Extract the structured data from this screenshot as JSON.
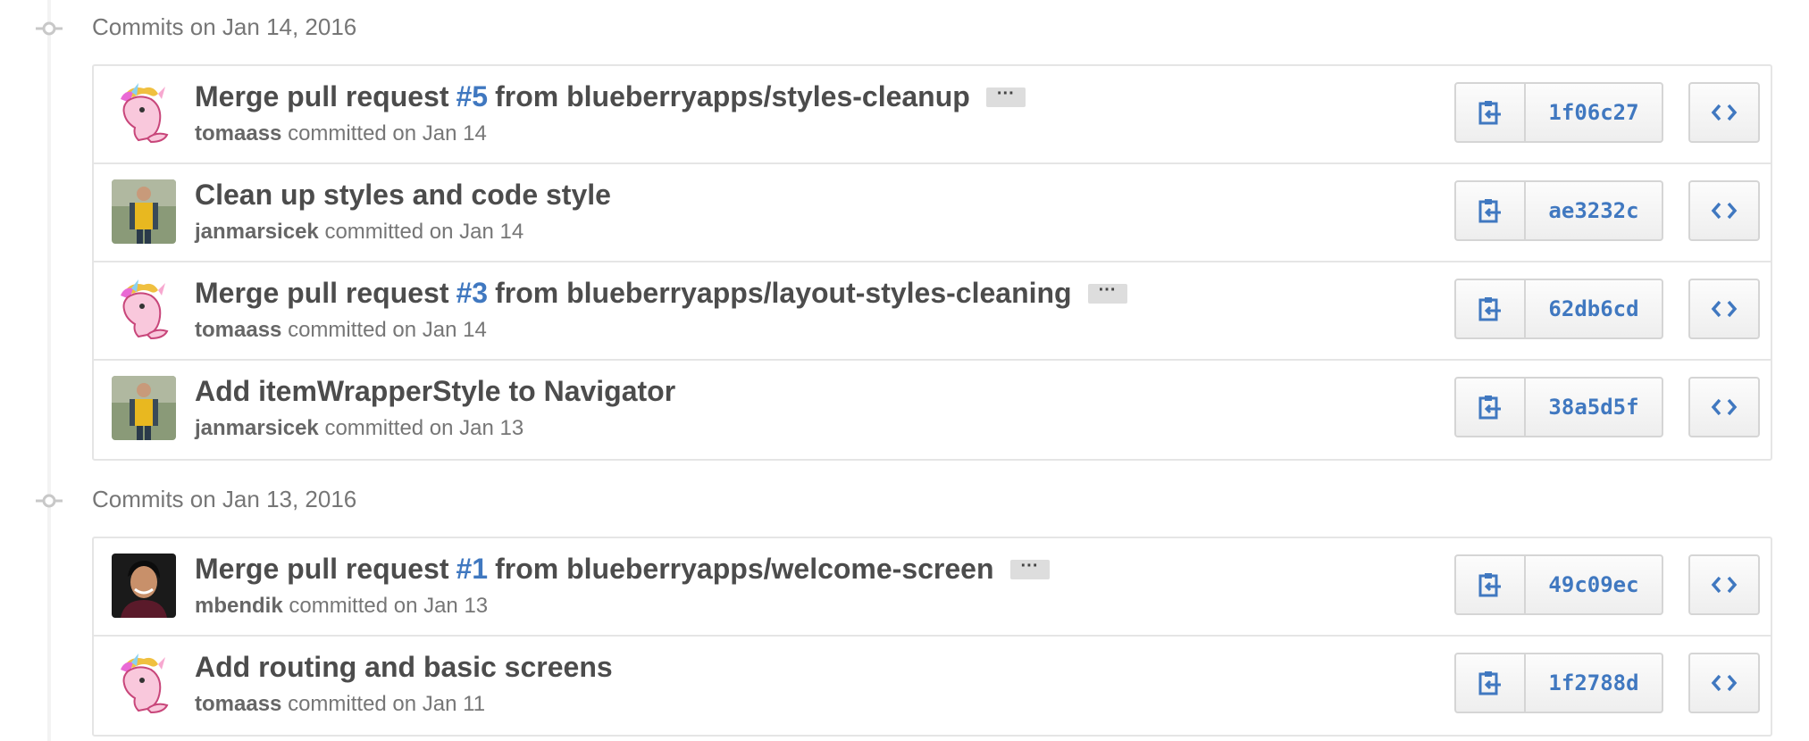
{
  "groups": [
    {
      "title": "Commits on Jan 14, 2016",
      "commits": [
        {
          "title_pre": "Merge pull request",
          "pr": "#5",
          "title_post": "from blueberryapps/styles-cleanup",
          "has_ellipsis": true,
          "ellipsis": "···",
          "author": "tomaass",
          "meta": "committed on Jan 14",
          "sha": "1f06c27",
          "avatar": "unicorn"
        },
        {
          "title_pre": "Clean up styles and code style",
          "pr": "",
          "title_post": "",
          "has_ellipsis": false,
          "ellipsis": "",
          "author": "janmarsicek",
          "meta": "committed on Jan 14",
          "sha": "ae3232c",
          "avatar": "person-yellow"
        },
        {
          "title_pre": "Merge pull request",
          "pr": "#3",
          "title_post": "from blueberryapps/layout-styles-cleaning",
          "has_ellipsis": true,
          "ellipsis": "···",
          "author": "tomaass",
          "meta": "committed on Jan 14",
          "sha": "62db6cd",
          "avatar": "unicorn"
        },
        {
          "title_pre": "Add itemWrapperStyle to Navigator",
          "pr": "",
          "title_post": "",
          "has_ellipsis": false,
          "ellipsis": "",
          "author": "janmarsicek",
          "meta": "committed on Jan 13",
          "sha": "38a5d5f",
          "avatar": "person-yellow"
        }
      ]
    },
    {
      "title": "Commits on Jan 13, 2016",
      "commits": [
        {
          "title_pre": "Merge pull request",
          "pr": "#1",
          "title_post": "from blueberryapps/welcome-screen",
          "has_ellipsis": true,
          "ellipsis": "···",
          "author": "mbendik",
          "meta": "committed on Jan 13",
          "sha": "49c09ec",
          "avatar": "person-dark"
        },
        {
          "title_pre": "Add routing and basic screens",
          "pr": "",
          "title_post": "",
          "has_ellipsis": false,
          "ellipsis": "",
          "author": "tomaass",
          "meta": "committed on Jan 11",
          "sha": "1f2788d",
          "avatar": "unicorn"
        }
      ]
    }
  ],
  "icons": {
    "copy": "clipboard-icon",
    "browse": "code-icon",
    "node": "commit-node-icon"
  },
  "colors": {
    "link": "#4078c0",
    "title": "#4c4c4c",
    "meta": "#767676",
    "border": "#e5e5e5"
  }
}
